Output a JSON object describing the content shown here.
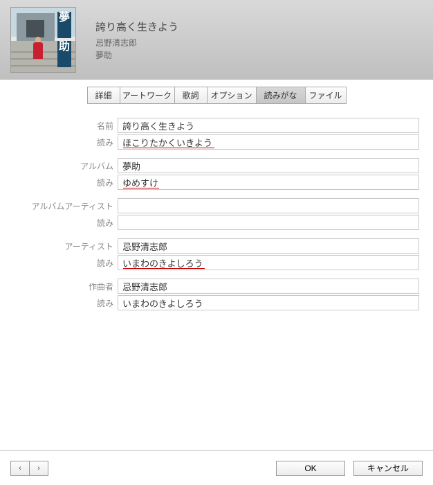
{
  "header": {
    "title": "誇り高く生きよう",
    "artist": "忌野清志郎",
    "album": "夢助",
    "artwork_kanji1": "夢",
    "artwork_kanji2": "助"
  },
  "tabs": [
    {
      "label": "詳細",
      "active": false
    },
    {
      "label": "アートワーク",
      "active": false
    },
    {
      "label": "歌詞",
      "active": false
    },
    {
      "label": "オプション",
      "active": false
    },
    {
      "label": "読みがな",
      "active": true
    },
    {
      "label": "ファイル",
      "active": false
    }
  ],
  "labels": {
    "name": "名前",
    "yomi": "読み",
    "album": "アルバム",
    "album_artist": "アルバムアーティスト",
    "artist": "アーティスト",
    "composer": "作曲者"
  },
  "fields": {
    "name": "誇り高く生きよう",
    "name_yomi": "ほこりたかくいきよう",
    "album": "夢助",
    "album_yomi": "ゆめすけ",
    "album_artist": "",
    "album_artist_yomi": "",
    "artist": "忌野清志郎",
    "artist_yomi": "いまわのきよしろう",
    "composer": "忌野清志郎",
    "composer_yomi": "いまわのきよしろう"
  },
  "underline_marks": {
    "name_yomi": true,
    "album_yomi": true,
    "artist_yomi": true,
    "composer_yomi": false
  },
  "footer": {
    "prev": "‹",
    "next": "›",
    "ok": "OK",
    "cancel": "キャンセル"
  }
}
